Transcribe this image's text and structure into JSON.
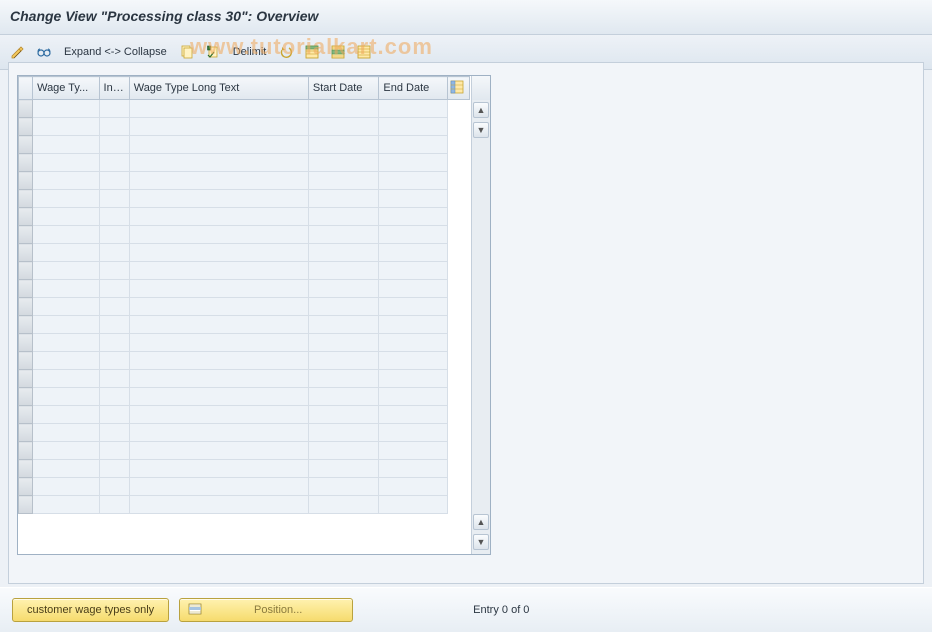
{
  "title": "Change View \"Processing class 30\": Overview",
  "watermark": "www.tutorialkart.com",
  "toolbar": {
    "expand_collapse_label": "Expand <-> Collapse",
    "delimit_label": "Delimit"
  },
  "table": {
    "columns": {
      "wage_type": "Wage Ty...",
      "inf": "Inf...",
      "wage_type_long": "Wage Type Long Text",
      "start_date": "Start Date",
      "end_date": "End Date"
    },
    "row_count": 23,
    "rows": []
  },
  "footer": {
    "customer_wage_types_label": "customer wage types only",
    "position_label": "Position...",
    "entry_status": "Entry 0 of 0"
  }
}
